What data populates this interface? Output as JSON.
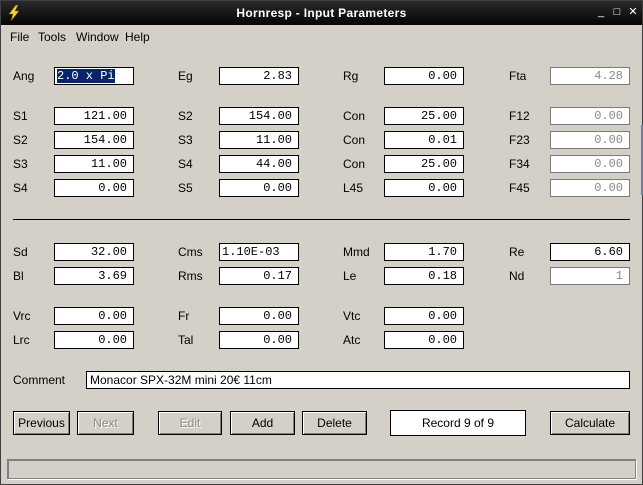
{
  "window": {
    "title": "Hornresp - Input Parameters"
  },
  "menu": [
    "File",
    "Tools",
    "Window",
    "Help"
  ],
  "row1": [
    {
      "label": "Ang",
      "value": "2.0 x Pi"
    },
    {
      "label": "Eg",
      "value": "2.83"
    },
    {
      "label": "Rg",
      "value": "0.00"
    },
    {
      "label": "Fta",
      "value": "4.28"
    }
  ],
  "rows_horn": [
    [
      {
        "label": "S1",
        "value": "121.00"
      },
      {
        "label": "S2",
        "value": "154.00"
      },
      {
        "label": "Con",
        "value": "25.00"
      },
      {
        "label": "F12",
        "value": "0.00"
      }
    ],
    [
      {
        "label": "S2",
        "value": "154.00"
      },
      {
        "label": "S3",
        "value": "11.00"
      },
      {
        "label": "Con",
        "value": "0.01"
      },
      {
        "label": "F23",
        "value": "0.00"
      }
    ],
    [
      {
        "label": "S3",
        "value": "11.00"
      },
      {
        "label": "S4",
        "value": "44.00"
      },
      {
        "label": "Con",
        "value": "25.00"
      },
      {
        "label": "F34",
        "value": "0.00"
      }
    ],
    [
      {
        "label": "S4",
        "value": "0.00"
      },
      {
        "label": "S5",
        "value": "0.00"
      },
      {
        "label": "L45",
        "value": "0.00"
      },
      {
        "label": "F45",
        "value": "0.00"
      }
    ]
  ],
  "rows_driver": [
    [
      {
        "label": "Sd",
        "value": "32.00"
      },
      {
        "label": "Cms",
        "value": "1.10E-03"
      },
      {
        "label": "Mmd",
        "value": "1.70"
      },
      {
        "label": "Re",
        "value": "6.60"
      }
    ],
    [
      {
        "label": "Bl",
        "value": "3.69"
      },
      {
        "label": "Rms",
        "value": "0.17"
      },
      {
        "label": "Le",
        "value": "0.18"
      },
      {
        "label": "Nd",
        "value": "1"
      }
    ]
  ],
  "rows_chamber": [
    [
      {
        "label": "Vrc",
        "value": "0.00"
      },
      {
        "label": "Fr",
        "value": "0.00"
      },
      {
        "label": "Vtc",
        "value": "0.00"
      }
    ],
    [
      {
        "label": "Lrc",
        "value": "0.00"
      },
      {
        "label": "Tal",
        "value": "0.00"
      },
      {
        "label": "Atc",
        "value": "0.00"
      }
    ]
  ],
  "comment": {
    "label": "Comment",
    "value": "Monacor SPX-32M mini 20€ 11cm"
  },
  "buttons": {
    "previous": "Previous",
    "next": "Next",
    "edit": "Edit",
    "add": "Add",
    "delete": "Delete",
    "calculate": "Calculate"
  },
  "record": "Record 9 of 9",
  "icons": {
    "app": "lightning-icon",
    "minimize": "minimize-icon",
    "maximize": "maximize-icon",
    "close": "close-icon"
  },
  "colors": {
    "titlebar": "#0a0a0a",
    "window": "#d4d0c8",
    "selection": "#0a246a",
    "disabled_text": "#8a8a8a"
  }
}
